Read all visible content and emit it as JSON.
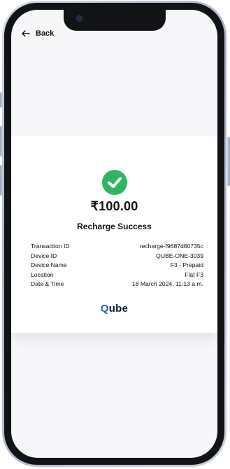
{
  "nav": {
    "back_label": "Back"
  },
  "receipt": {
    "amount": "₹100.00",
    "status": "Recharge Success",
    "details": [
      {
        "label": "Transaction ID",
        "value": "recharge-f9687d80735c"
      },
      {
        "label": "Device ID",
        "value": "QUBE-ONE-3039"
      },
      {
        "label": "Device Name",
        "value": "F3 - Prepaid"
      },
      {
        "label": "Location",
        "value": "Flat F3"
      },
      {
        "label": "Date & Time",
        "value": "18 March 2024, 11:13 a.m."
      }
    ],
    "brand_first": "Q",
    "brand_rest": "ube"
  },
  "colors": {
    "success_green": "#2fb663",
    "brand_blue": "#2a5bd7",
    "brand_navy": "#0d1b3d"
  },
  "icons": {
    "back": "arrow-left-icon",
    "success": "check-circle-icon"
  }
}
